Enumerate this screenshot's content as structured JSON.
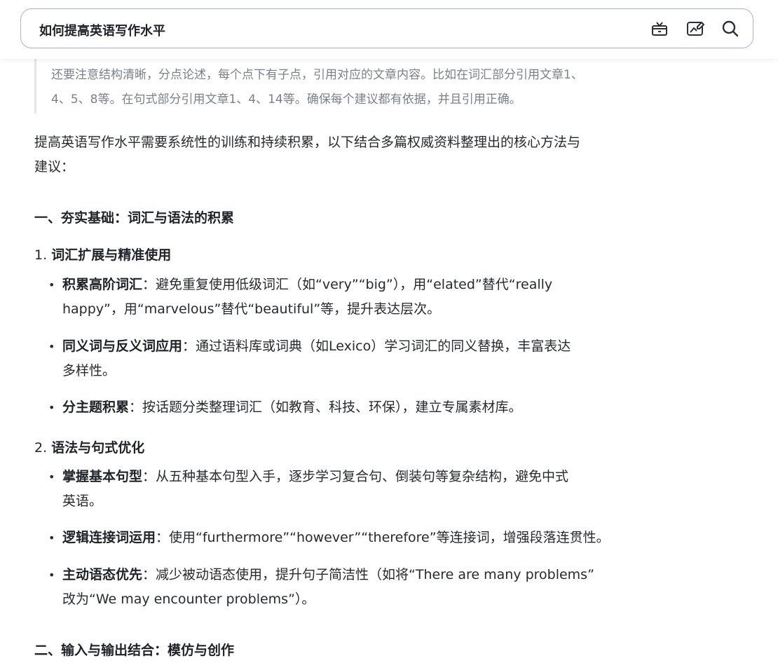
{
  "header": {
    "query": "如何提高英语写作水平",
    "icons": [
      "gift-box-icon",
      "edit-image-icon",
      "search-icon"
    ]
  },
  "quote": {
    "line1": "还要注意结构清晰，分点论述，每个点下有子点，引用对应的文章内容。比如在词汇部分引用文章1、",
    "line2": "4、5、8等。在句式部分引用文章1、4、14等。确保每个建议都有依据，并且引用正确。"
  },
  "intro": {
    "line1": "提高英语写作水平需要系统性的训练和持续积累，以下结合多篇权威资料整理出的核心方法与",
    "line2": "建议："
  },
  "sections": [
    {
      "heading": "一、夯实基础：词汇与语法的积累",
      "subsections": [
        {
          "num": "1.",
          "title": "词汇扩展与精准使用",
          "bullets": [
            {
              "term": "积累高阶词汇",
              "line1": "：避免重复使用低级词汇（如“very”“big”），用“elated”替代“really",
              "line2": "happy”，用“marvelous”替代“beautiful”等，提升表达层次。"
            },
            {
              "term": "同义词与反义词应用",
              "line1": "：通过语料库或词典（如Lexico）学习词汇的同义替换，丰富表达",
              "line2": "多样性。"
            },
            {
              "term": "分主题积累",
              "line1": "：按话题分类整理词汇（如教育、科技、环保），建立专属素材库。",
              "line2": ""
            }
          ]
        },
        {
          "num": "2.",
          "title": "语法与句式优化",
          "bullets": [
            {
              "term": "掌握基本句型",
              "line1": "：从五种基本句型入手，逐步学习复合句、倒装句等复杂结构，避免中式",
              "line2": "英语。"
            },
            {
              "term": "逻辑连接词运用",
              "line1": "：使用“furthermore”“however”“therefore”等连接词，增强段落连贯性。",
              "line2": ""
            },
            {
              "term": "主动语态优先",
              "line1": "：减少被动语态使用，提升句子简洁性（如将“There are many problems”",
              "line2": "改为“We may encounter problems”）。"
            }
          ]
        }
      ]
    },
    {
      "heading": "二、输入与输出结合：模仿与创作",
      "subsections": []
    }
  ]
}
